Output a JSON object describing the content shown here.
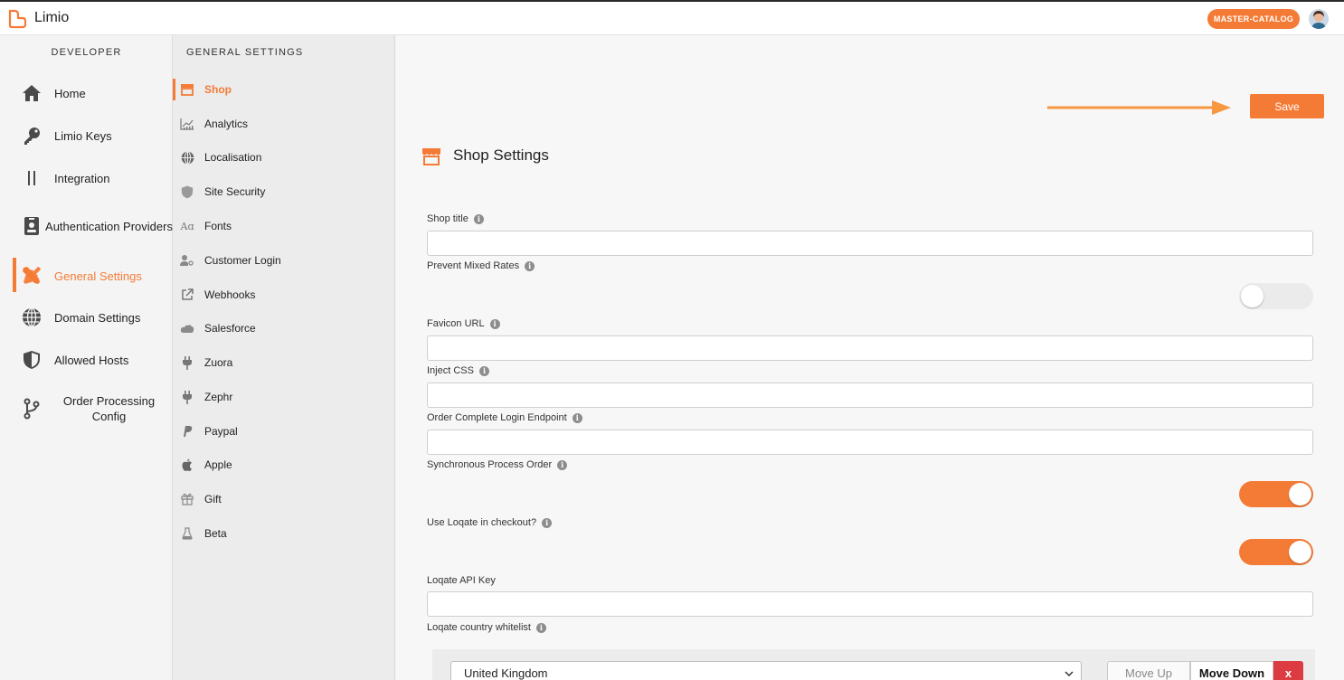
{
  "app": {
    "title": "Limio"
  },
  "header": {
    "catalog_badge": "MASTER-CATALOG"
  },
  "sidebar": {
    "heading": "DEVELOPER",
    "items": [
      {
        "label": "Home",
        "icon": "home-icon"
      },
      {
        "label": "Limio Keys",
        "icon": "key-icon"
      },
      {
        "label": "Integration",
        "icon": "integration-icon"
      },
      {
        "label": "Authentication Providers",
        "icon": "id-badge-icon"
      },
      {
        "label": "General Settings",
        "icon": "tools-icon",
        "active": true
      },
      {
        "label": "Domain Settings",
        "icon": "globe-icon"
      },
      {
        "label": "Allowed Hosts",
        "icon": "shield-icon"
      },
      {
        "label": "Order Processing Config",
        "icon": "branch-icon"
      }
    ]
  },
  "subnav": {
    "heading": "GENERAL SETTINGS",
    "items": [
      {
        "label": "Shop",
        "icon": "shop-icon",
        "active": true
      },
      {
        "label": "Analytics",
        "icon": "analytics-icon"
      },
      {
        "label": "Localisation",
        "icon": "globe-icon"
      },
      {
        "label": "Site Security",
        "icon": "shield-icon"
      },
      {
        "label": "Fonts",
        "icon": "font-icon"
      },
      {
        "label": "Customer Login",
        "icon": "user-key-icon"
      },
      {
        "label": "Webhooks",
        "icon": "external-link-icon"
      },
      {
        "label": "Salesforce",
        "icon": "cloud-icon"
      },
      {
        "label": "Zuora",
        "icon": "plug-icon"
      },
      {
        "label": "Zephr",
        "icon": "plug-icon"
      },
      {
        "label": "Paypal",
        "icon": "paypal-icon"
      },
      {
        "label": "Apple",
        "icon": "apple-icon"
      },
      {
        "label": "Gift",
        "icon": "gift-icon"
      },
      {
        "label": "Beta",
        "icon": "flask-icon"
      }
    ]
  },
  "main": {
    "save_label": "Save",
    "section_title": "Shop Settings",
    "fields": {
      "shop_title": {
        "label": "Shop title",
        "value": ""
      },
      "prevent_mixed_rates": {
        "label": "Prevent Mixed Rates",
        "enabled": false
      },
      "favicon_url": {
        "label": "Favicon URL",
        "value": ""
      },
      "inject_css": {
        "label": "Inject CSS",
        "value": ""
      },
      "order_complete_login_endpoint": {
        "label": "Order Complete Login Endpoint",
        "value": ""
      },
      "synchronous_process_order": {
        "label": "Synchronous Process Order",
        "enabled": true
      },
      "use_loqate": {
        "label": "Use Loqate in checkout?",
        "enabled": true
      },
      "loqate_api_key": {
        "label": "Loqate API Key",
        "value": ""
      },
      "loqate_country_whitelist": {
        "label": "Loqate country whitelist"
      }
    },
    "whitelist": {
      "selected_country": "United Kingdom",
      "move_up_label": "Move Up",
      "move_down_label": "Move Down",
      "delete_label": "x"
    }
  },
  "colors": {
    "accent": "#f47b36",
    "danger": "#dc3b42"
  }
}
